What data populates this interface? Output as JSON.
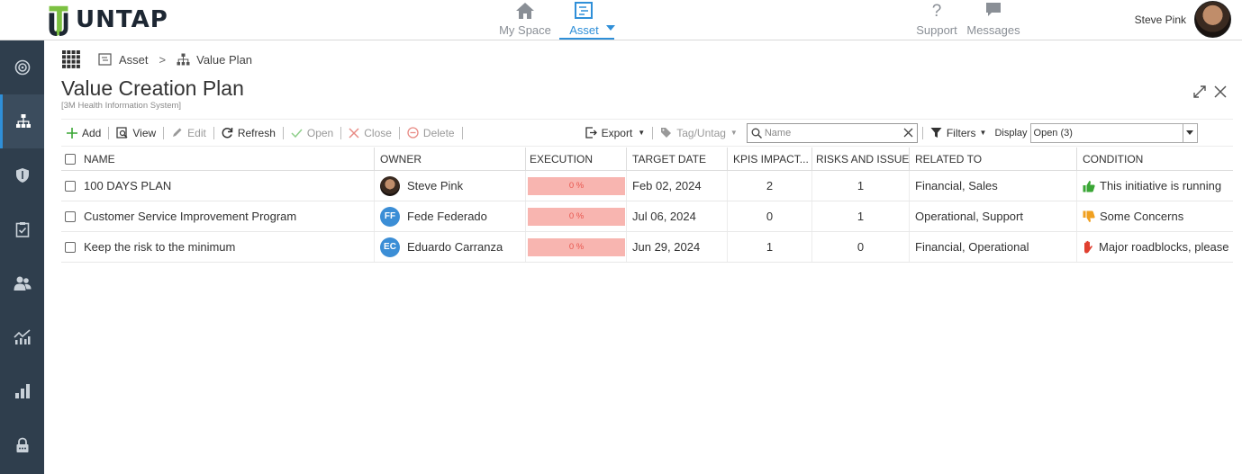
{
  "brand": {
    "name": "UNTAP"
  },
  "topnav": {
    "my_space": "My Space",
    "asset": "Asset",
    "support": "Support",
    "messages": "Messages"
  },
  "user": {
    "name": "Steve Pink"
  },
  "breadcrumb": {
    "items": [
      "Asset",
      "Value Plan"
    ]
  },
  "page": {
    "title": "Value Creation Plan",
    "subtitle": "[3M Health Information System]"
  },
  "toolbar": {
    "add": "Add",
    "view": "View",
    "edit": "Edit",
    "refresh": "Refresh",
    "open": "Open",
    "close": "Close",
    "delete": "Delete",
    "export": "Export",
    "tag": "Tag/Untag",
    "search_placeholder": "Name",
    "filters": "Filters",
    "display_label": "Display",
    "display_value": "Open (3)"
  },
  "columns": [
    "NAME",
    "OWNER",
    "EXECUTION",
    "TARGET DATE",
    "KPIS IMPACT...",
    "RISKS AND ISSUES",
    "RELATED TO",
    "CONDITION"
  ],
  "rows": [
    {
      "name": "100 DAYS PLAN",
      "owner": "Steve Pink",
      "initials": "",
      "execution": "0 %",
      "target_date": "Feb 02, 2024",
      "kpis": "2",
      "risks": "1",
      "related": "Financial, Sales",
      "condition": "This initiative is running",
      "condition_icon": "thumbs-up-icon",
      "condition_color": "#3aa635"
    },
    {
      "name": "Customer Service Improvement Program",
      "owner": "Fede Federado",
      "initials": "FF",
      "execution": "0 %",
      "target_date": "Jul 06, 2024",
      "kpis": "0",
      "risks": "1",
      "related": "Operational, Support",
      "condition": "Some Concerns",
      "condition_icon": "thumbs-down-icon",
      "condition_color": "#f0a020"
    },
    {
      "name": "Keep the risk to the minimum",
      "owner": "Eduardo Carranza",
      "initials": "EC",
      "execution": "0 %",
      "target_date": "Jun 29, 2024",
      "kpis": "1",
      "risks": "0",
      "related": "Financial, Operational",
      "condition": "Major roadblocks, please",
      "condition_icon": "stop-hand-icon",
      "condition_color": "#e04030"
    }
  ],
  "colors": {
    "accent": "#2f8fd8",
    "sidebar": "#2f3e4d",
    "execution_bg": "#f8b5b0",
    "execution_text": "#e8564e"
  }
}
